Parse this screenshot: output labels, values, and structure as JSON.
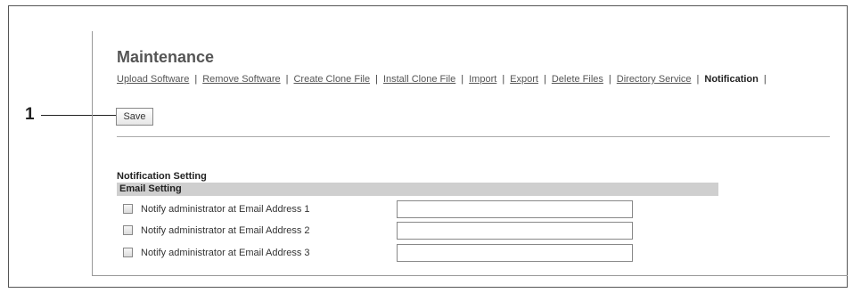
{
  "callout": {
    "number": "1"
  },
  "page": {
    "title": "Maintenance"
  },
  "nav": {
    "items": [
      {
        "label": "Upload Software",
        "active": false
      },
      {
        "label": "Remove Software",
        "active": false
      },
      {
        "label": "Create Clone File",
        "active": false
      },
      {
        "label": "Install Clone File",
        "active": false
      },
      {
        "label": "Import",
        "active": false
      },
      {
        "label": "Export",
        "active": false
      },
      {
        "label": "Delete Files",
        "active": false
      },
      {
        "label": "Directory Service",
        "active": false
      },
      {
        "label": "Notification",
        "active": true
      }
    ],
    "separator": "|"
  },
  "toolbar": {
    "save_label": "Save"
  },
  "notification": {
    "section_title": "Notification Setting",
    "subsection_title": "Email Setting",
    "rows": [
      {
        "label": "Notify administrator at Email Address 1",
        "checked": false,
        "value": ""
      },
      {
        "label": "Notify administrator at Email Address 2",
        "checked": false,
        "value": ""
      },
      {
        "label": "Notify administrator at Email Address 3",
        "checked": false,
        "value": ""
      }
    ]
  }
}
